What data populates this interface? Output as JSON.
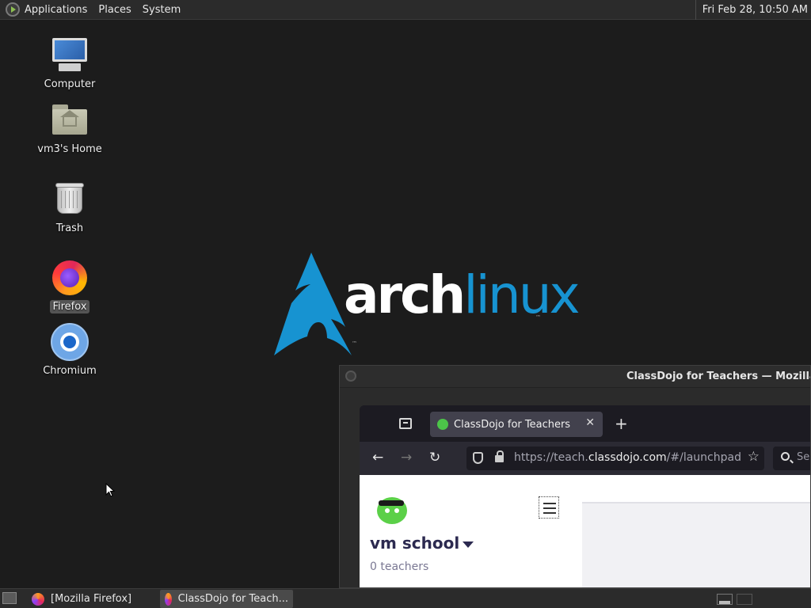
{
  "top_panel": {
    "menus": [
      "Applications",
      "Places",
      "System"
    ],
    "clock": "Fri Feb 28, 10:50 AM"
  },
  "desktop": {
    "icons": [
      {
        "label": "Computer",
        "icon": "computer-icon"
      },
      {
        "label": "vm3's Home",
        "icon": "home-folder-icon"
      },
      {
        "label": "Trash",
        "icon": "trash-icon"
      },
      {
        "label": "Firefox",
        "icon": "firefox-icon"
      },
      {
        "label": "Chromium",
        "icon": "chromium-icon"
      }
    ],
    "wallpaper": {
      "word_bold": "arch",
      "word_light": "linux",
      "tm": "™",
      "accent": "#1793d1"
    }
  },
  "firefox_window": {
    "title": "ClassDojo for Teachers — Mozilla Firefox",
    "tab_title": "ClassDojo for Teachers",
    "url_prefix": "https://teach.",
    "url_host": "classdojo.com",
    "url_suffix": "/#/launchpad",
    "search_placeholder": "Se",
    "page": {
      "school_name": "vm school",
      "teacher_count": "0 teachers"
    }
  },
  "taskbar": {
    "tasks": [
      "[Mozilla Firefox]",
      "ClassDojo for Teach..."
    ]
  }
}
